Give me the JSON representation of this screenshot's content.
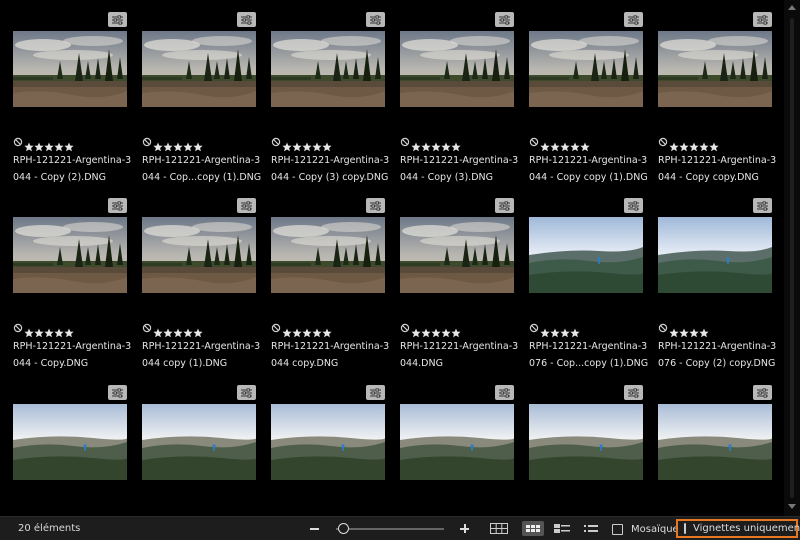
{
  "colors": {
    "accent": "#e87722",
    "background": "#000000",
    "statusbar": "#1d1d1d"
  },
  "status_bar": {
    "item_count": "20 éléments",
    "zoom_out": "−",
    "zoom_in": "+",
    "zoom_level": 0.02,
    "view_modes": [
      "grid-view-icon",
      "tiles-view-icon",
      "details-view-icon",
      "list-view-icon"
    ],
    "active_view": "tiles-view-icon",
    "mosaic_label": "Mosaïque",
    "mosaic_checked": false,
    "thumbnails_only_label": "Vignettes uniquement",
    "thumbnails_only_checked": false
  },
  "items": [
    {
      "line1": "RPH-121221-Argentina-3",
      "line2": "044 - Copy (2).DNG",
      "rating": 5,
      "scene": "a"
    },
    {
      "line1": "RPH-121221-Argentina-3",
      "line2": "044 - Cop...copy (1).DNG",
      "rating": 5,
      "scene": "a"
    },
    {
      "line1": "RPH-121221-Argentina-3",
      "line2": "044 - Copy (3) copy.DNG",
      "rating": 5,
      "scene": "a"
    },
    {
      "line1": "RPH-121221-Argentina-3",
      "line2": "044 - Copy (3).DNG",
      "rating": 5,
      "scene": "a"
    },
    {
      "line1": "RPH-121221-Argentina-3",
      "line2": "044 - Copy copy (1).DNG",
      "rating": 5,
      "scene": "a"
    },
    {
      "line1": "RPH-121221-Argentina-3",
      "line2": "044 - Copy copy.DNG",
      "rating": 5,
      "scene": "a"
    },
    {
      "line1": "RPH-121221-Argentina-3",
      "line2": "044 - Copy.DNG",
      "rating": 5,
      "scene": "a"
    },
    {
      "line1": "RPH-121221-Argentina-3",
      "line2": "044 copy (1).DNG",
      "rating": 5,
      "scene": "a"
    },
    {
      "line1": "RPH-121221-Argentina-3",
      "line2": "044 copy.DNG",
      "rating": 5,
      "scene": "a"
    },
    {
      "line1": "RPH-121221-Argentina-3",
      "line2": "044.DNG",
      "rating": 5,
      "scene": "a"
    },
    {
      "line1": "RPH-121221-Argentina-3",
      "line2": "076 - Cop...copy (1).DNG",
      "rating": 4,
      "scene": "b"
    },
    {
      "line1": "RPH-121221-Argentina-3",
      "line2": "076 - Copy (2) copy.DNG",
      "rating": 4,
      "scene": "b"
    },
    {
      "line1": "",
      "line2": "",
      "rating": 0,
      "scene": "c"
    },
    {
      "line1": "",
      "line2": "",
      "rating": 0,
      "scene": "c"
    },
    {
      "line1": "",
      "line2": "",
      "rating": 0,
      "scene": "c"
    },
    {
      "line1": "",
      "line2": "",
      "rating": 0,
      "scene": "c"
    },
    {
      "line1": "",
      "line2": "",
      "rating": 0,
      "scene": "c"
    },
    {
      "line1": "",
      "line2": "",
      "rating": 0,
      "scene": "c"
    }
  ]
}
